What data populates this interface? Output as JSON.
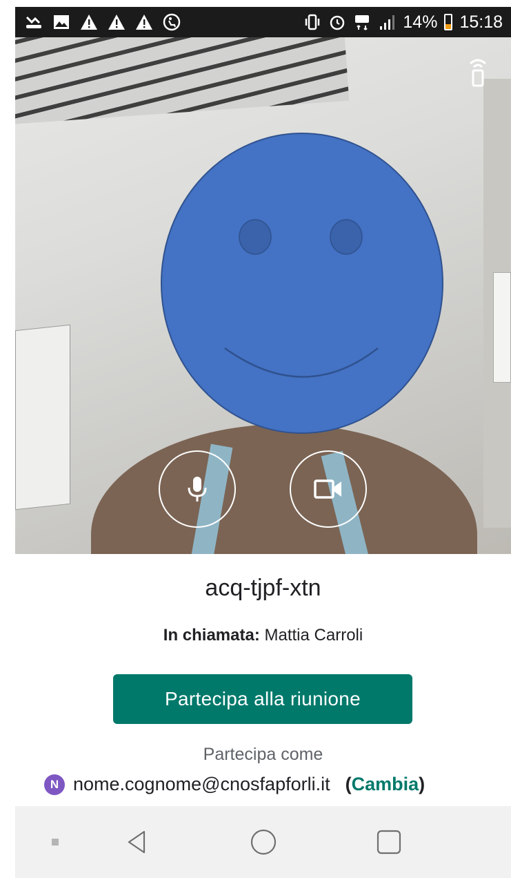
{
  "status_bar": {
    "battery_percent": "14%",
    "time": "15:18",
    "left_icons": [
      "missed-call-icon",
      "image-icon",
      "warning-icon",
      "warning-icon",
      "warning-icon",
      "accessibility-icon"
    ],
    "right_icons": [
      "vibrate-icon",
      "alarm-icon",
      "4g-icon",
      "signal-icon",
      "battery-icon"
    ],
    "battery_level": 0.14
  },
  "camera": {
    "cast_icon": "cast-icon",
    "mic_icon": "microphone-icon",
    "video_icon": "video-camera-icon"
  },
  "meeting": {
    "code": "acq-tjpf-xtn",
    "in_call_label": "In chiamata:",
    "in_call_name": "Mattia Carroli",
    "join_button": "Partecipa alla riunione",
    "join_as_label": "Partecipa come",
    "avatar_letter": "N",
    "email": "nome.cognome@cnosfapforli.it",
    "paren_open": "(",
    "change_label": "Cambia",
    "paren_close": ")"
  },
  "colors": {
    "accent": "#00796b",
    "avatar": "#7e57c2",
    "smiley": "#4472c4",
    "status_bar": "#1b1b1b"
  }
}
